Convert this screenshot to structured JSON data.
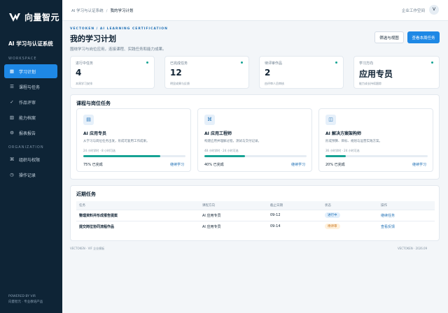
{
  "brand": {
    "name": "向量智元",
    "system_title": "AI 学习与认证系统",
    "colors": {
      "accent": "#1e88e5",
      "sidebar": "#0e2436",
      "progress": "#16a394"
    }
  },
  "sidebar": {
    "group_workspace": "WORKSPACE",
    "group_org": "ORGANIZATION",
    "items": [
      {
        "label": "学习计划",
        "icon": "grid-icon"
      },
      {
        "label": "课程与任务",
        "icon": "list-icon"
      },
      {
        "label": "作品评审",
        "icon": "review-icon"
      },
      {
        "label": "能力档案",
        "icon": "chart-icon"
      },
      {
        "label": "报表报告",
        "icon": "gear-icon"
      },
      {
        "label": "组织与权限",
        "icon": "nodes-icon"
      },
      {
        "label": "操作记录",
        "icon": "history-icon"
      }
    ],
    "powered_line1": "POWERED BY VIR",
    "powered_line2": "向量智元 · 专业教培产品"
  },
  "topbar": {
    "crumb_root": "AI 学习与认证系统",
    "crumb_current": "我的学习计划",
    "workspace": "企业工作空间",
    "avatar": "V"
  },
  "header": {
    "eyebrow": "VECTOKEN / AI LEARNING CERTIFICATION",
    "title": "我的学习计划",
    "desc": "围绕学习与岗位应用，连接课程、实践任务和能力成果。",
    "filter_button": "筛选与视图",
    "primary_button": "查看本周任务"
  },
  "stats": [
    {
      "label": "进行中任务",
      "value": "4",
      "sub": "本周学习安排"
    },
    {
      "label": "已完成任务",
      "value": "12",
      "sub": "明显成果与反馈"
    },
    {
      "label": "待评审作品",
      "value": "2",
      "sub": "由评审人员审核"
    },
    {
      "label": "学习方向",
      "value": "应用专员",
      "sub": "能力成长持续跟踪"
    }
  ],
  "courses": {
    "title": "课程与岗位任务",
    "items": [
      {
        "icon": "doc-icon",
        "name": "AI 应用专员",
        "desc": "从学习与岗位任务出发，形成可复用工作成果。",
        "hours": "24 小时学时 · 8 小时可选",
        "progress": 0.75,
        "progress_text": "75% 已完成",
        "link": "继续学习"
      },
      {
        "icon": "command-icon",
        "name": "AI 应用工程师",
        "desc": "构建应用并理解过程，测试与交付记录。",
        "hours": "48 小时学时 · 24 小时可选",
        "progress": 0.4,
        "progress_text": "40% 已完成",
        "link": "继续学习"
      },
      {
        "icon": "columns-icon",
        "name": "AI 解决方案架构师",
        "desc": "形成预算、目标、规划与运营实践方案。",
        "hours": "36 小时学时 · 24 小时可选",
        "progress": 0.2,
        "progress_text": "20% 已完成",
        "link": "继续学习"
      }
    ]
  },
  "tasks": {
    "title": "近期任务",
    "headers": [
      "任务",
      "课程方向",
      "截止日期",
      "状态",
      "操作"
    ],
    "rows": [
      {
        "task": "整理资料并形成报告提案",
        "course": "AI 应用专员",
        "due": "09-12",
        "status": "进行中",
        "action": "继续任务"
      },
      {
        "task": "提交岗位协同流程作品",
        "course": "AI 应用专员",
        "due": "09-14",
        "status": "待评审",
        "action": "查看反馈"
      }
    ]
  },
  "footer": {
    "left": "VECTOKEN · VIF 企业模板",
    "right": "VECTOKEN · 2026.09"
  }
}
